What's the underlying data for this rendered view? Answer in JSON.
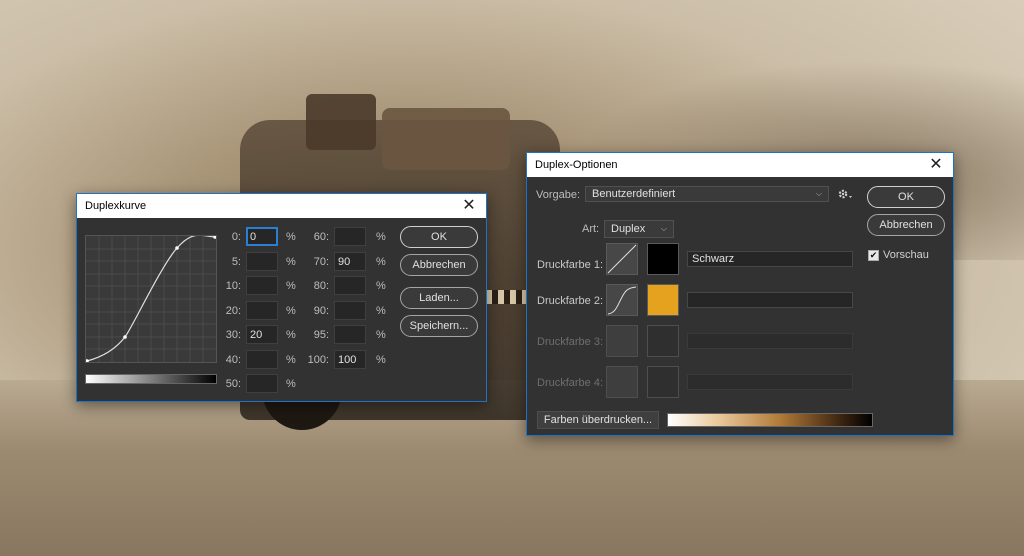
{
  "duplexkurve": {
    "title": "Duplexkurve",
    "close_glyph": "✕",
    "fields": {
      "f0": {
        "label": "0:",
        "value": "0"
      },
      "f5": {
        "label": "5:",
        "value": ""
      },
      "f10": {
        "label": "10:",
        "value": ""
      },
      "f20": {
        "label": "20:",
        "value": ""
      },
      "f30": {
        "label": "30:",
        "value": "20"
      },
      "f40": {
        "label": "40:",
        "value": ""
      },
      "f50": {
        "label": "50:",
        "value": ""
      },
      "f60": {
        "label": "60:",
        "value": ""
      },
      "f70": {
        "label": "70:",
        "value": "90"
      },
      "f80": {
        "label": "80:",
        "value": ""
      },
      "f90": {
        "label": "90:",
        "value": ""
      },
      "f95": {
        "label": "95:",
        "value": ""
      },
      "f100": {
        "label": "100:",
        "value": "100"
      }
    },
    "percent": "%",
    "buttons": {
      "ok": "OK",
      "cancel": "Abbrechen",
      "load": "Laden...",
      "save": "Speichern..."
    }
  },
  "duplexoptionen": {
    "title": "Duplex-Optionen",
    "close_glyph": "✕",
    "preset_label": "Vorgabe:",
    "preset_value": "Benutzerdefiniert",
    "type_label": "Art:",
    "type_value": "Duplex",
    "inks": [
      {
        "label": "Druckfarbe 1:",
        "name": "Schwarz",
        "color": "#000000",
        "enabled": true
      },
      {
        "label": "Druckfarbe 2:",
        "name": "",
        "color": "#e5a21f",
        "enabled": true
      },
      {
        "label": "Druckfarbe 3:",
        "name": "",
        "color": "#2f2f2f",
        "enabled": false
      },
      {
        "label": "Druckfarbe 4:",
        "name": "",
        "color": "#2f2f2f",
        "enabled": false
      }
    ],
    "overprint_button": "Farben überdrucken...",
    "buttons": {
      "ok": "OK",
      "cancel": "Abbrechen"
    },
    "preview_label": "Vorschau",
    "preview_checked": true,
    "checkmark": "✔",
    "gear_icon": "gear-icon"
  }
}
